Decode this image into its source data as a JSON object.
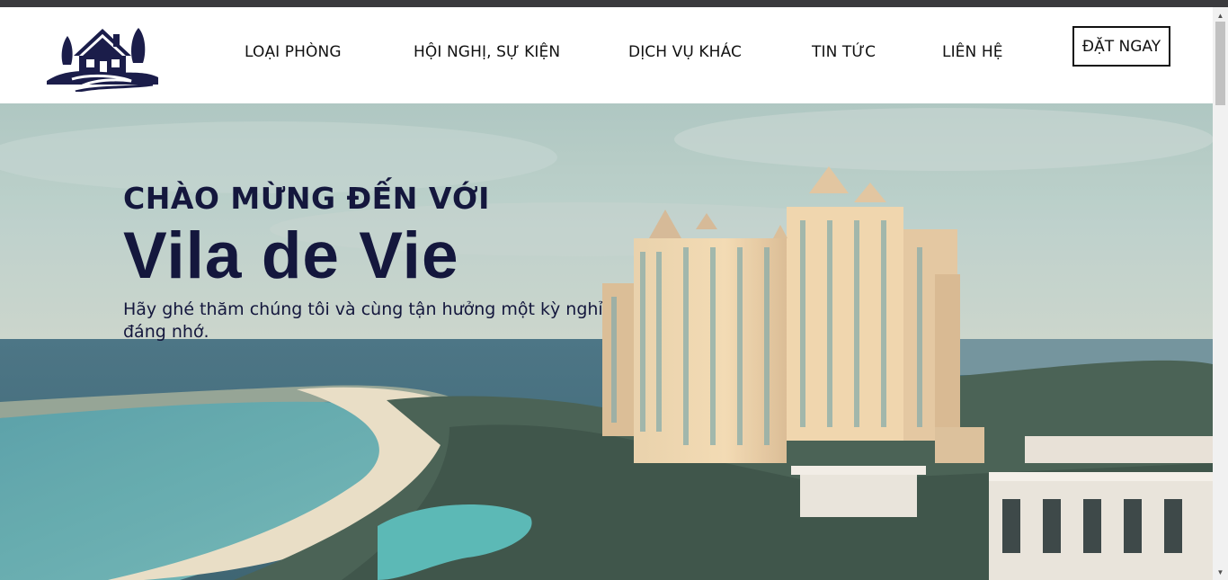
{
  "nav": {
    "items": [
      {
        "label": "LOẠI PHÒNG"
      },
      {
        "label": "HỘI NGHỊ, SỰ KIỆN"
      },
      {
        "label": "DỊCH VỤ KHÁC"
      },
      {
        "label": "TIN TỨC"
      },
      {
        "label": "LIÊN HỆ"
      }
    ],
    "cta_label": "ĐẶT NGAY"
  },
  "hero": {
    "welcome": "CHÀO MỪNG ĐẾN VỚI",
    "brand": "Vila de Vie",
    "tagline": "Hãy ghé thăm chúng tôi và cùng tận hưởng một kỳ nghỉ đáng nhớ."
  },
  "colors": {
    "brand_navy": "#14173d",
    "header_bg": "#ffffff",
    "top_strip": "#3a3a3d"
  },
  "icons": {
    "logo": "house-with-trees-logo",
    "scroll_up": "triangle-up-icon",
    "scroll_down": "triangle-down-icon"
  }
}
